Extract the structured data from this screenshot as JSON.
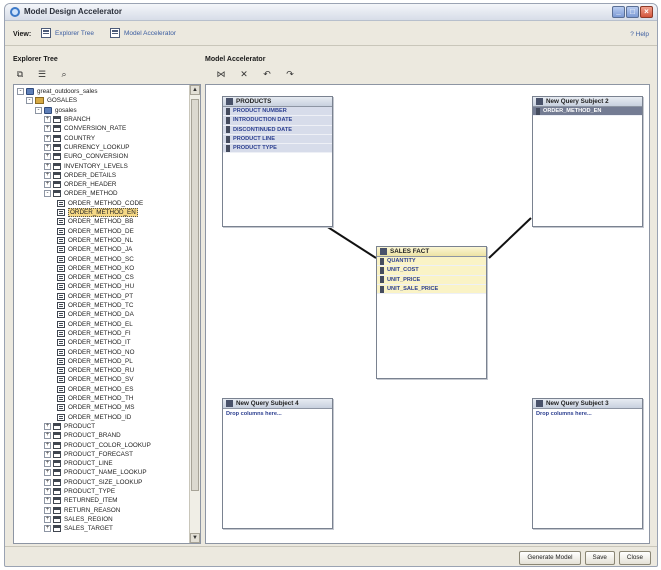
{
  "window": {
    "title": "Model Design Accelerator"
  },
  "viewbar": {
    "label": "View:",
    "explorer_tree": "Explorer Tree",
    "model_accelerator": "Model Accelerator",
    "help": "Help"
  },
  "explorer": {
    "title": "Explorer Tree",
    "tree": [
      {
        "label": "great_outdoors_sales",
        "level": 0,
        "exp": "-",
        "icon": "db"
      },
      {
        "label": "GOSALES",
        "level": 1,
        "exp": "-",
        "icon": "folder"
      },
      {
        "label": "gosales",
        "level": 2,
        "exp": "-",
        "icon": "db"
      },
      {
        "label": "BRANCH",
        "level": 3,
        "exp": "+",
        "icon": "table"
      },
      {
        "label": "CONVERSION_RATE",
        "level": 3,
        "exp": "+",
        "icon": "table"
      },
      {
        "label": "COUNTRY",
        "level": 3,
        "exp": "+",
        "icon": "table"
      },
      {
        "label": "CURRENCY_LOOKUP",
        "level": 3,
        "exp": "+",
        "icon": "table"
      },
      {
        "label": "EURO_CONVERSION",
        "level": 3,
        "exp": "+",
        "icon": "table"
      },
      {
        "label": "INVENTORY_LEVELS",
        "level": 3,
        "exp": "+",
        "icon": "table"
      },
      {
        "label": "ORDER_DETAILS",
        "level": 3,
        "exp": "+",
        "icon": "table"
      },
      {
        "label": "ORDER_HEADER",
        "level": 3,
        "exp": "+",
        "icon": "table"
      },
      {
        "label": "ORDER_METHOD",
        "level": 3,
        "exp": "-",
        "icon": "table"
      },
      {
        "label": "ORDER_METHOD_CODE",
        "level": 4,
        "icon": "col"
      },
      {
        "label": "ORDER_METHOD_EN",
        "level": 4,
        "icon": "col",
        "selected": true
      },
      {
        "label": "ORDER_METHOD_BB",
        "level": 4,
        "icon": "col"
      },
      {
        "label": "ORDER_METHOD_DE",
        "level": 4,
        "icon": "col"
      },
      {
        "label": "ORDER_METHOD_NL",
        "level": 4,
        "icon": "col"
      },
      {
        "label": "ORDER_METHOD_JA",
        "level": 4,
        "icon": "col"
      },
      {
        "label": "ORDER_METHOD_SC",
        "level": 4,
        "icon": "col"
      },
      {
        "label": "ORDER_METHOD_KO",
        "level": 4,
        "icon": "col"
      },
      {
        "label": "ORDER_METHOD_CS",
        "level": 4,
        "icon": "col"
      },
      {
        "label": "ORDER_METHOD_HU",
        "level": 4,
        "icon": "col"
      },
      {
        "label": "ORDER_METHOD_PT",
        "level": 4,
        "icon": "col"
      },
      {
        "label": "ORDER_METHOD_TC",
        "level": 4,
        "icon": "col"
      },
      {
        "label": "ORDER_METHOD_DA",
        "level": 4,
        "icon": "col"
      },
      {
        "label": "ORDER_METHOD_EL",
        "level": 4,
        "icon": "col"
      },
      {
        "label": "ORDER_METHOD_FI",
        "level": 4,
        "icon": "col"
      },
      {
        "label": "ORDER_METHOD_IT",
        "level": 4,
        "icon": "col"
      },
      {
        "label": "ORDER_METHOD_NO",
        "level": 4,
        "icon": "col"
      },
      {
        "label": "ORDER_METHOD_PL",
        "level": 4,
        "icon": "col"
      },
      {
        "label": "ORDER_METHOD_RU",
        "level": 4,
        "icon": "col"
      },
      {
        "label": "ORDER_METHOD_SV",
        "level": 4,
        "icon": "col"
      },
      {
        "label": "ORDER_METHOD_ES",
        "level": 4,
        "icon": "col"
      },
      {
        "label": "ORDER_METHOD_TH",
        "level": 4,
        "icon": "col"
      },
      {
        "label": "ORDER_METHOD_MS",
        "level": 4,
        "icon": "col"
      },
      {
        "label": "ORDER_METHOD_ID",
        "level": 4,
        "icon": "col"
      },
      {
        "label": "PRODUCT",
        "level": 3,
        "exp": "+",
        "icon": "table"
      },
      {
        "label": "PRODUCT_BRAND",
        "level": 3,
        "exp": "+",
        "icon": "table"
      },
      {
        "label": "PRODUCT_COLOR_LOOKUP",
        "level": 3,
        "exp": "+",
        "icon": "table"
      },
      {
        "label": "PRODUCT_FORECAST",
        "level": 3,
        "exp": "+",
        "icon": "table"
      },
      {
        "label": "PRODUCT_LINE",
        "level": 3,
        "exp": "+",
        "icon": "table"
      },
      {
        "label": "PRODUCT_NAME_LOOKUP",
        "level": 3,
        "exp": "+",
        "icon": "table"
      },
      {
        "label": "PRODUCT_SIZE_LOOKUP",
        "level": 3,
        "exp": "+",
        "icon": "table"
      },
      {
        "label": "PRODUCT_TYPE",
        "level": 3,
        "exp": "+",
        "icon": "table"
      },
      {
        "label": "RETURNED_ITEM",
        "level": 3,
        "exp": "+",
        "icon": "table"
      },
      {
        "label": "RETURN_REASON",
        "level": 3,
        "exp": "+",
        "icon": "table"
      },
      {
        "label": "SALES_REGION",
        "level": 3,
        "exp": "+",
        "icon": "table"
      },
      {
        "label": "SALES_TARGET",
        "level": 3,
        "exp": "+",
        "icon": "table"
      }
    ]
  },
  "model": {
    "title": "Model Accelerator",
    "products": {
      "title": "PRODUCTS",
      "rows": [
        "PRODUCT NUMBER",
        "INTRODUCTION DATE",
        "DISCONTINUED DATE",
        "PRODUCT LINE",
        "PRODUCT TYPE"
      ]
    },
    "qs2": {
      "title": "New Query Subject 2",
      "rows": [
        "ORDER_METHOD_EN"
      ]
    },
    "fact": {
      "title": "SALES FACT",
      "rows": [
        "QUANTITY",
        "UNIT_COST",
        "UNIT_PRICE",
        "UNIT_SALE_PRICE"
      ]
    },
    "qs4": {
      "title": "New Query Subject 4",
      "hint": "Drop columns here..."
    },
    "qs3": {
      "title": "New Query Subject 3",
      "hint": "Drop columns here..."
    }
  },
  "buttons": {
    "generate": "Generate Model",
    "save": "Save",
    "close": "Close"
  },
  "colors": {
    "selection": "#f6d986",
    "fact_header": "#ede2a4",
    "link_text": "#2c3f90"
  }
}
